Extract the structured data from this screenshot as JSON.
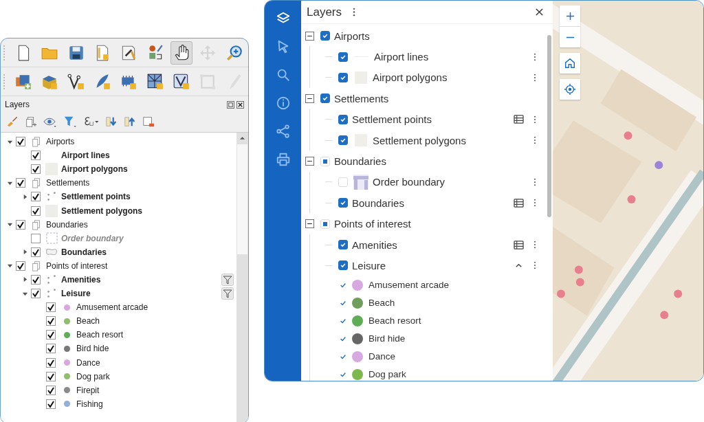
{
  "qgis": {
    "toolbars": [
      [
        {
          "kind": "new-file",
          "pressed": false,
          "disabled": false
        },
        {
          "kind": "folder",
          "pressed": false,
          "disabled": false
        },
        {
          "kind": "save",
          "pressed": false,
          "disabled": false
        },
        {
          "kind": "layout",
          "pressed": false,
          "disabled": false
        },
        {
          "kind": "style-doc",
          "pressed": false,
          "disabled": false
        },
        {
          "kind": "label-style",
          "pressed": false,
          "disabled": false
        },
        {
          "kind": "hand",
          "pressed": true,
          "disabled": false
        },
        {
          "kind": "move",
          "pressed": false,
          "disabled": true
        },
        {
          "kind": "zoom-in",
          "pressed": false,
          "disabled": false
        }
      ],
      [
        {
          "kind": "add-layer",
          "pressed": false,
          "disabled": false
        },
        {
          "kind": "database",
          "pressed": false,
          "disabled": false
        },
        {
          "kind": "vertex",
          "pressed": false,
          "disabled": false
        },
        {
          "kind": "feather",
          "pressed": false,
          "disabled": false
        },
        {
          "kind": "chip",
          "pressed": false,
          "disabled": false
        },
        {
          "kind": "grid",
          "pressed": false,
          "disabled": false
        },
        {
          "kind": "polygon",
          "pressed": false,
          "disabled": false
        },
        {
          "kind": "node",
          "pressed": false,
          "disabled": true
        },
        {
          "kind": "pencil",
          "pressed": false,
          "disabled": true
        }
      ]
    ],
    "panel_title": "Layers",
    "tree": [
      {
        "kind": "group",
        "label": "Airports",
        "checked": true,
        "expanded": true,
        "children": [
          {
            "kind": "layer",
            "label": "Airport lines",
            "checked": true,
            "disabled": false
          },
          {
            "kind": "layer",
            "label": "Airport polygons",
            "checked": true,
            "disabled": false,
            "symbol": {
              "kind": "fill"
            }
          }
        ]
      },
      {
        "kind": "group",
        "label": "Settlements",
        "checked": true,
        "expanded": true,
        "children": [
          {
            "kind": "layer",
            "label": "Settlement points",
            "checked": true,
            "disabled": false,
            "symbol": {
              "kind": "points"
            },
            "expanded": false
          },
          {
            "kind": "layer",
            "label": "Settlement polygons",
            "checked": true,
            "disabled": false,
            "symbol": {
              "kind": "fill"
            }
          }
        ]
      },
      {
        "kind": "group",
        "label": "Boundaries",
        "checked": true,
        "expanded": true,
        "children": [
          {
            "kind": "layer",
            "label": "Order boundary",
            "checked": false,
            "disabled": true,
            "symbol": {
              "kind": "dashed"
            }
          },
          {
            "kind": "layer",
            "label": "Boundaries",
            "checked": true,
            "disabled": false,
            "symbol": {
              "kind": "outline"
            },
            "expanded": false
          }
        ]
      },
      {
        "kind": "group",
        "label": "Points of interest",
        "checked": true,
        "expanded": true,
        "children": [
          {
            "kind": "layer",
            "label": "Amenities",
            "checked": true,
            "disabled": false,
            "symbol": {
              "kind": "points"
            },
            "expanded": false,
            "filtered": true
          },
          {
            "kind": "layer",
            "label": "Leisure",
            "checked": true,
            "disabled": false,
            "symbol": {
              "kind": "points"
            },
            "expanded": true,
            "filtered": true,
            "children": [
              {
                "kind": "category",
                "label": "Amusement arcade",
                "checked": true,
                "color": "#d9a6e0"
              },
              {
                "kind": "category",
                "label": "Beach",
                "checked": true,
                "color": "#8fbf6e"
              },
              {
                "kind": "category",
                "label": "Beach resort",
                "checked": true,
                "color": "#5fad56"
              },
              {
                "kind": "category",
                "label": "Bird hide",
                "checked": true,
                "color": "#777777"
              },
              {
                "kind": "category",
                "label": "Dance",
                "checked": true,
                "color": "#d9a6e0"
              },
              {
                "kind": "category",
                "label": "Dog park",
                "checked": true,
                "color": "#8fbf6e"
              },
              {
                "kind": "category",
                "label": "Firepit",
                "checked": true,
                "color": "#8a8a8a"
              },
              {
                "kind": "category",
                "label": "Fishing",
                "checked": true,
                "color": "#8fb0d8"
              }
            ]
          }
        ]
      }
    ]
  },
  "web": {
    "sidebar": [
      {
        "kind": "layers",
        "selected": true
      },
      {
        "kind": "select",
        "selected": false
      },
      {
        "kind": "search",
        "selected": false
      },
      {
        "kind": "info",
        "selected": false
      },
      {
        "kind": "share",
        "selected": false
      },
      {
        "kind": "print",
        "selected": false
      }
    ],
    "panel_title": "Layers",
    "tree": [
      {
        "kind": "group",
        "label": "Airports",
        "checked": true,
        "partial": false,
        "expanded": true,
        "children": [
          {
            "kind": "layer",
            "label": "Airport lines",
            "checked": true,
            "symbol": {
              "kind": "line"
            }
          },
          {
            "kind": "layer",
            "label": "Airport polygons",
            "checked": true,
            "symbol": {
              "kind": "fill"
            }
          }
        ]
      },
      {
        "kind": "group",
        "label": "Settlements",
        "checked": true,
        "partial": false,
        "expanded": true,
        "children": [
          {
            "kind": "layer",
            "label": "Settlement points",
            "checked": true,
            "table": true
          },
          {
            "kind": "layer",
            "label": "Settlement polygons",
            "checked": true,
            "symbol": {
              "kind": "fill"
            }
          }
        ]
      },
      {
        "kind": "group",
        "label": "Boundaries",
        "checked": false,
        "partial": true,
        "expanded": true,
        "children": [
          {
            "kind": "layer",
            "label": "Order boundary",
            "checked": false,
            "symbol": {
              "kind": "pattern"
            }
          },
          {
            "kind": "layer",
            "label": "Boundaries",
            "checked": true,
            "table": true
          }
        ]
      },
      {
        "kind": "group",
        "label": "Points of interest",
        "checked": false,
        "partial": true,
        "expanded": true,
        "children": [
          {
            "kind": "layer",
            "label": "Amenities",
            "checked": true,
            "table": true
          },
          {
            "kind": "layer",
            "label": "Leisure",
            "checked": true,
            "expanded": true,
            "children": [
              {
                "kind": "category",
                "label": "Amusement arcade",
                "checked": true,
                "color": "#d8a8e0"
              },
              {
                "kind": "category",
                "label": "Beach",
                "checked": true,
                "color": "#6f9e5c"
              },
              {
                "kind": "category",
                "label": "Beach resort",
                "checked": true,
                "color": "#5fad56"
              },
              {
                "kind": "category",
                "label": "Bird hide",
                "checked": true,
                "color": "#666666"
              },
              {
                "kind": "category",
                "label": "Dance",
                "checked": true,
                "color": "#d8a8e0"
              },
              {
                "kind": "category",
                "label": "Dog park",
                "checked": true,
                "color": "#7db84e"
              }
            ]
          }
        ]
      }
    ]
  }
}
